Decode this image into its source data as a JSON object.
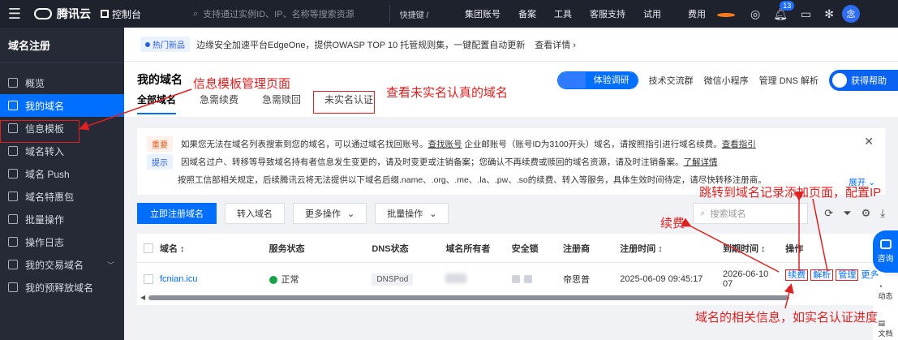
{
  "topbar": {
    "brand": "腾讯云",
    "console": "控制台",
    "search_placeholder": "支持通过实例ID、IP、名称等搜索资源",
    "shortcut": "快捷键 /",
    "nav": [
      "集团账号",
      "备案",
      "工具",
      "客服支持",
      "试用",
      "费用"
    ],
    "bell_count": "13",
    "avatar": "念"
  },
  "sidebar": {
    "title": "域名注册",
    "items": [
      {
        "label": "概览"
      },
      {
        "label": "我的域名"
      },
      {
        "label": "信息模板"
      },
      {
        "label": "域名转入"
      },
      {
        "label": "域名 Push"
      },
      {
        "label": "域名特惠包"
      },
      {
        "label": "批量操作"
      },
      {
        "label": "操作日志"
      },
      {
        "label": "我的交易域名"
      },
      {
        "label": "我的预释放域名"
      }
    ]
  },
  "banner": {
    "tag": "热门新品",
    "text": "边缘安全加速平台EdgeOne，提供OWASP TOP 10 托管规则集，一键配置自动更新",
    "detail": "查看详情 ›"
  },
  "page": {
    "title": "我的域名",
    "tabs": [
      "全部域名",
      "急需续费",
      "急需赎回",
      "未实名认证"
    ],
    "head_right": {
      "survey": "体验调研",
      "group": "技术交流群",
      "mini": "微信小程序",
      "dns": "管理 DNS 解析",
      "help": "获得帮助"
    }
  },
  "notices": {
    "important_tag": "重要",
    "important_text_a": "如果您无法在域名列表搜索到您的域名，可以通过域名找回账号。",
    "important_link1": "查找账号",
    "important_text_b": " 企业邮账号（账号ID为3100开头）域名，请按照指引进行域名续费。",
    "important_link2": "查看指引",
    "tip_tag": "提示",
    "tip_text": "因域名过户、转移等导致域名持有者信息发生变更的，请及时变更或注销备案；您确认不再续费或赎回的域名资源，请及时注销备案。",
    "tip_link": "了解详情",
    "tip_text2": "按照工信部相关规定，后续腾讯云将无法提供以下域名后缀.name、.org、.me、.la、.pw、.so的续费、转入等服务，具体生效时间待定，请尽快转移注册商。",
    "expand": "展开 ⌄"
  },
  "toolbar": {
    "register": "立即注册域名",
    "transfer": "转入域名",
    "more_ops": "更多操作",
    "batch_ops": "批量操作",
    "search_placeholder": "搜索域名"
  },
  "table": {
    "headers": {
      "name": "域名 ↕",
      "status": "服务状态",
      "dns": "DNS状态",
      "owner": "域名所有者",
      "lock": "安全锁",
      "registrar": "注册商",
      "reg_time": "注册时间 ↕",
      "exp_time": "到期时间 ↕",
      "ops": "操作"
    },
    "rows": [
      {
        "name": "fcnian.icu",
        "status": "正常",
        "dns": "DNSPod",
        "registrar": "帝思普",
        "reg_time": "2025-06-09 09:45:17",
        "exp_time": "2026-06-10 07",
        "op_renew": "续费",
        "op_resolve": "解析",
        "op_manage": "管理",
        "op_more": "更多"
      }
    ]
  },
  "annotations": {
    "template_page": "信息模板管理页面",
    "unverified": "查看未实名认真的域名",
    "jump_dns": "跳转到域名记录添加页面，配置IP",
    "renew": "续费",
    "info": "域名的相关信息，如实名认证进度"
  },
  "float": {
    "consult": "咨询",
    "dynamic": "动态",
    "doc": "文档"
  },
  "colors": {
    "primary": "#006eff",
    "annotation": "#e02020"
  }
}
